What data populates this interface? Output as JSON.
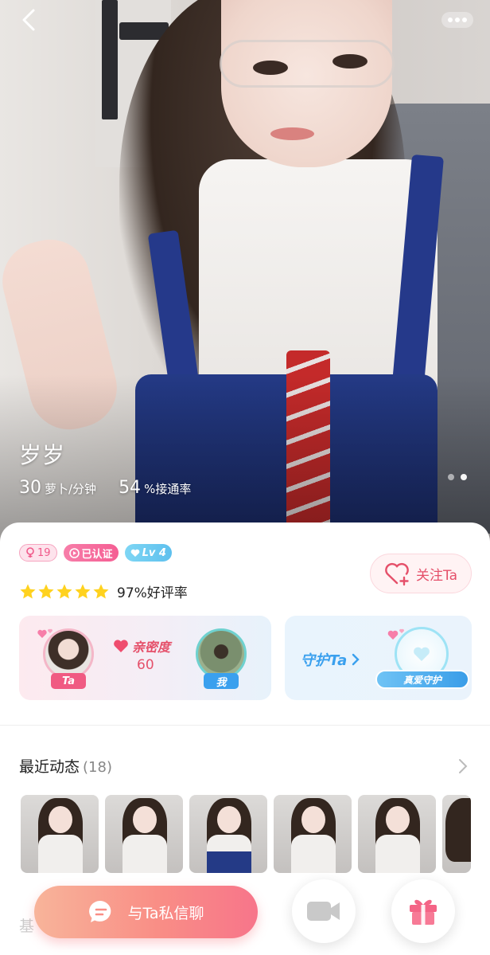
{
  "host": {
    "name": "岁岁",
    "price_value": "30",
    "price_unit": "萝卜/分钟",
    "answer_rate_value": "54",
    "answer_rate_unit": "%接通率"
  },
  "gallery": {
    "pages": 2,
    "current": 1
  },
  "badges": {
    "age": "19",
    "verified": "已认证",
    "level": "Lv 4"
  },
  "follow_label": "关注Ta",
  "rating": {
    "stars": 5,
    "text": "97%好评率"
  },
  "intimacy": {
    "label": "亲密度",
    "value": "60",
    "ta_tag": "Ta",
    "me_tag": "我"
  },
  "guard": {
    "label": "守护Ta",
    "banner": "真爱守护"
  },
  "moments": {
    "title": "最近动态",
    "count": "(18)"
  },
  "bottom": {
    "chat_label": "与Ta私信聊",
    "base_info_label": "基"
  },
  "colors": {
    "accent_pink": "#e5506a",
    "accent_blue": "#3aa0ee",
    "star": "#ffd21f"
  }
}
